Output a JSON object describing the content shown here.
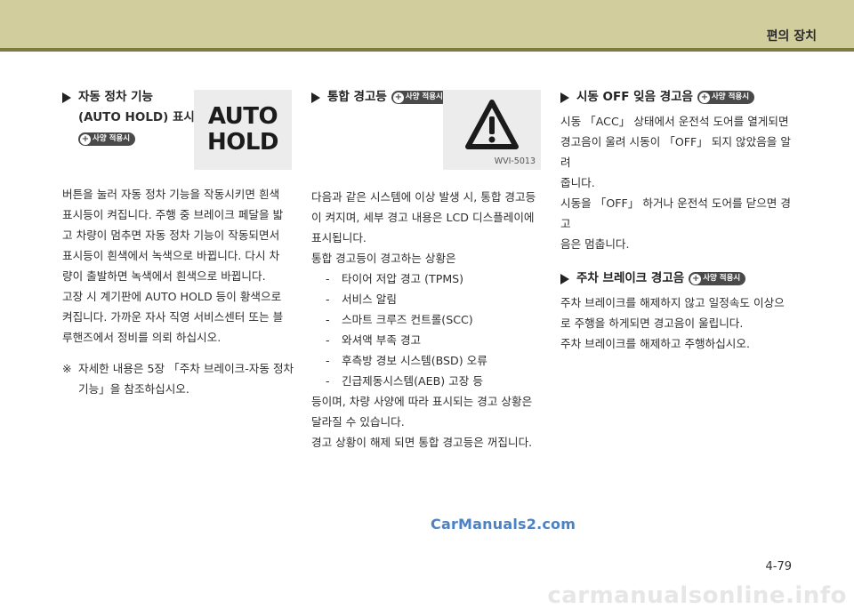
{
  "header": {
    "section_title": "편의 장치"
  },
  "badge_label": "사양 적용시",
  "col1": {
    "heading": "자동 정차 기능",
    "subheading": "(AUTO HOLD) 표시등",
    "image": {
      "line1": "AUTO",
      "line2": "HOLD"
    },
    "paragraph_lines": [
      "버튼을 눌러 자동 정차 기능을 작동시키면 흰색",
      "표시등이 켜집니다. 주행 중 브레이크 페달을 밟",
      "고 차량이 멈추면 자동 정차 기능이 작동되면서",
      "표시등이 흰색에서 녹색으로 바뀝니다. 다시 차",
      "량이 출발하면 녹색에서 흰색으로 바뀝니다.",
      "고장 시 계기판에 AUTO HOLD 등이 황색으로",
      "켜집니다. 가까운 자사 직영 서비스센터 또는 블",
      "루핸즈에서 정비를 의뢰 하십시오."
    ],
    "note_mark": "※",
    "note_lines": [
      "자세한 내용은 5장 「주차 브레이크-자동 정차",
      "기능」을 참조하십시오."
    ]
  },
  "col2": {
    "heading": "통합 경고등",
    "image_code": "WVI-5013",
    "intro_lines": [
      "다음과 같은 시스템에 이상 발생 시, 통합 경고등",
      "이 켜지며, 세부 경고 내용은 LCD 디스플레이에",
      "표시됩니다.",
      "통합 경고등이 경고하는 상황은"
    ],
    "list_items": [
      "타이어 저압 경고 (TPMS)",
      "서비스 알림",
      "스마트 크루즈 컨트롤(SCC)",
      "와셔액 부족 경고",
      "후측방 경보 시스템(BSD) 오류",
      "긴급제동시스템(AEB) 고장 등"
    ],
    "outro_lines": [
      "등이며, 차량 사양에 따라 표시되는 경고 상황은",
      "달라질 수 있습니다.",
      "경고 상황이 해제 되면 통합 경고등은 꺼집니다."
    ]
  },
  "col3": {
    "heading1": "시동 OFF 잊음 경고음",
    "para1_lines": [
      "시동 「ACC」 상태에서 운전석 도어를 열게되면",
      "경고음이 울려 시동이 「OFF」 되지 않았음을 알려",
      "줍니다.",
      "시동을 「OFF」 하거나 운전석 도어를 닫으면 경고",
      "음은 멈춥니다."
    ],
    "heading2": "주차 브레이크 경고음",
    "para2_lines": [
      "주차 브레이크를 해제하지 않고 일정속도 이상으",
      "로 주행을 하게되면 경고음이 울립니다.",
      "주차 브레이크를 해제하고 주행하십시오."
    ]
  },
  "watermark": "CarManuals2.com",
  "page_number": "4-79",
  "footer_watermark": "carmanualsonline.info"
}
